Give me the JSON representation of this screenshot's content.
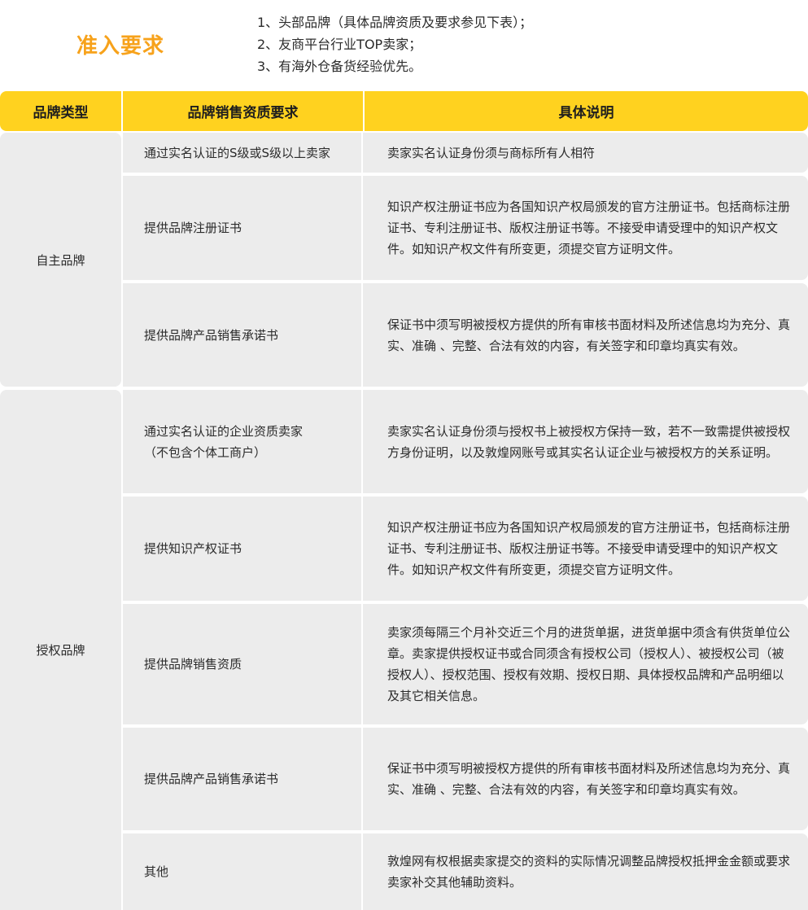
{
  "title": "准入要求",
  "requirements": [
    "1、头部品牌（具体品牌资质及要求参见下表）；",
    "2、友商平台行业TOP卖家；",
    "3、有海外仓备货经验优先。"
  ],
  "table": {
    "headers": [
      "品牌类型",
      "品牌销售资质要求",
      "具体说明"
    ],
    "groups": [
      {
        "type": "自主品牌",
        "rows": [
          {
            "req": "通过实名认证的S级或S级以上卖家",
            "desc": "卖家实名认证身份须与商标所有人相符"
          },
          {
            "req": "提供品牌注册证书",
            "desc": "知识产权注册证书应为各国知识产权局颁发的官方注册证书。包括商标注册证书、专利注册证书、版权注册证书等。不接受申请受理中的知识产权文件。如知识产权文件有所变更，须提交官方证明文件。"
          },
          {
            "req": "提供品牌产品销售承诺书",
            "desc": "保证书中须写明被授权方提供的所有审核书面材料及所述信息均为充分、真实、准确 、完整、合法有效的内容，有关签字和印章均真实有效。"
          }
        ]
      },
      {
        "type": "授权品牌",
        "rows": [
          {
            "req": "通过实名认证的企业资质卖家\n（不包含个体工商户）",
            "desc": "卖家实名认证身份须与授权书上被授权方保持一致，若不一致需提供被授权方身份证明，以及敦煌网账号或其实名认证企业与被授权方的关系证明。"
          },
          {
            "req": "提供知识产权证书",
            "desc": "知识产权注册证书应为各国知识产权局颁发的官方注册证书，包括商标注册证书、专利注册证书、版权注册证书等。不接受申请受理中的知识产权文件。如知识产权文件有所变更，须提交官方证明文件。"
          },
          {
            "req": "提供品牌销售资质",
            "desc": "卖家须每隔三个月补交近三个月的进货单据，进货单据中须含有供货单位公章。卖家提供授权证书或合同须含有授权公司（授权人）、被授权公司（被授权人）、授权范围、授权有效期、授权日期、具体授权品牌和产品明细以及其它相关信息。"
          },
          {
            "req": "提供品牌产品销售承诺书",
            "desc": "保证书中须写明被授权方提供的所有审核书面材料及所述信息均为充分、真实、准确 、完整、合法有效的内容，有关签字和印章均真实有效。"
          },
          {
            "req": "其他",
            "desc": "敦煌网有权根据卖家提交的资料的实际情况调整品牌授权抵押金金额或要求卖家补交其他辅助资料。"
          }
        ]
      }
    ]
  }
}
